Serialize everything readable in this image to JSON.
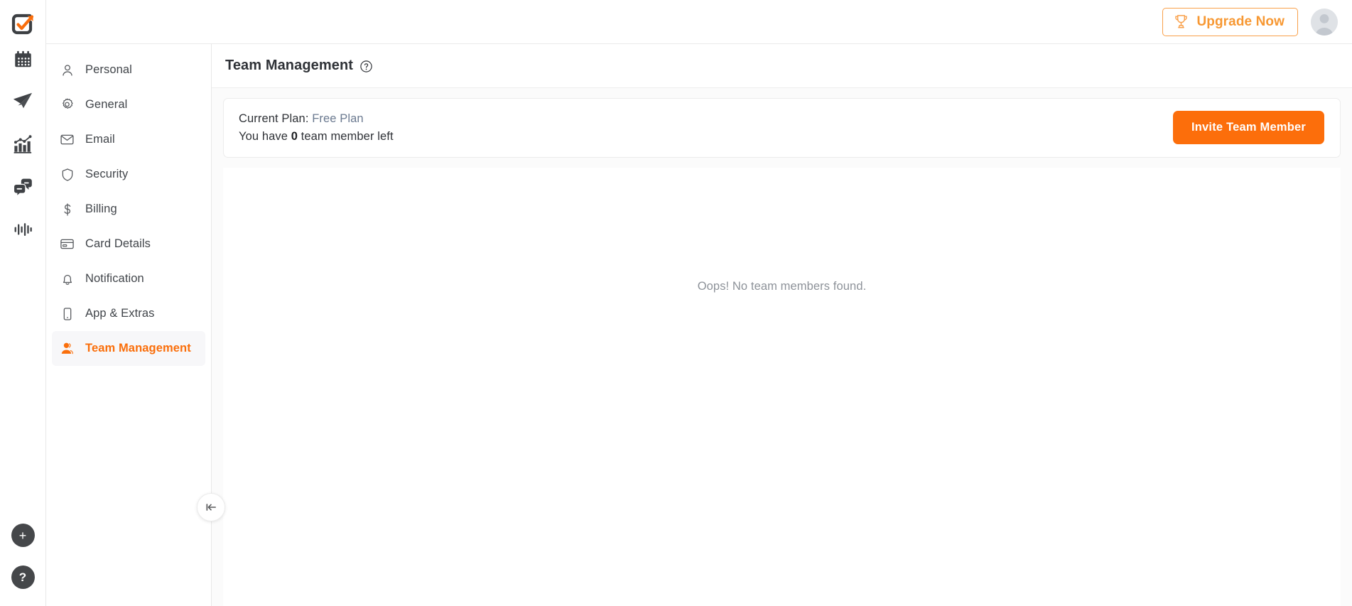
{
  "rail": {
    "logo": {
      "name": "app-logo",
      "alt": "Checkmark app logo"
    },
    "items": [
      {
        "icon": "calendar-icon",
        "label": "Calendar"
      },
      {
        "icon": "paper-plane-icon",
        "label": "Campaigns"
      },
      {
        "icon": "bar-chart-growth-icon",
        "label": "Analytics"
      },
      {
        "icon": "chat-bubbles-icon",
        "label": "Messages"
      },
      {
        "icon": "audio-waveform-icon",
        "label": "Activity"
      }
    ],
    "bottom": [
      {
        "icon": "plus-icon",
        "glyph": "+",
        "label": "Add new"
      },
      {
        "icon": "question-mark-icon",
        "glyph": "?",
        "label": "Help"
      }
    ]
  },
  "topbar": {
    "upgrade_label": "Upgrade Now",
    "upgrade_icon": "trophy-icon",
    "avatar_name": "user-avatar"
  },
  "settings_nav": {
    "items": [
      {
        "icon": "person-outline-icon",
        "label": "Personal",
        "active": false
      },
      {
        "icon": "gear-icon",
        "label": "General",
        "active": false
      },
      {
        "icon": "envelope-icon",
        "label": "Email",
        "active": false
      },
      {
        "icon": "shield-icon",
        "label": "Security",
        "active": false
      },
      {
        "icon": "dollar-sign-icon",
        "label": "Billing",
        "active": false
      },
      {
        "icon": "credit-card-icon",
        "label": "Card Details",
        "active": false
      },
      {
        "icon": "bell-icon",
        "label": "Notification",
        "active": false
      },
      {
        "icon": "mobile-phone-icon",
        "label": "App & Extras",
        "active": false
      },
      {
        "icon": "person-filled-icon",
        "label": "Team Management",
        "active": true
      }
    ],
    "collapse_icon": "collapse-left-icon"
  },
  "page": {
    "title": "Team Management",
    "help_icon": "question-circle-icon"
  },
  "plan_card": {
    "current_plan_label": "Current Plan:",
    "current_plan_value": "Free Plan",
    "members_prefix": "You have",
    "members_count": "0",
    "members_suffix": "team member left",
    "invite_label": "Invite Team Member"
  },
  "members_panel": {
    "empty_message": "Oops! No team members found."
  },
  "colors": {
    "accent_orange": "#fc6e0b",
    "upgrade_orange": "#f79833",
    "muted_text": "#8d9299",
    "link_blue_gray": "#6b7a90"
  }
}
